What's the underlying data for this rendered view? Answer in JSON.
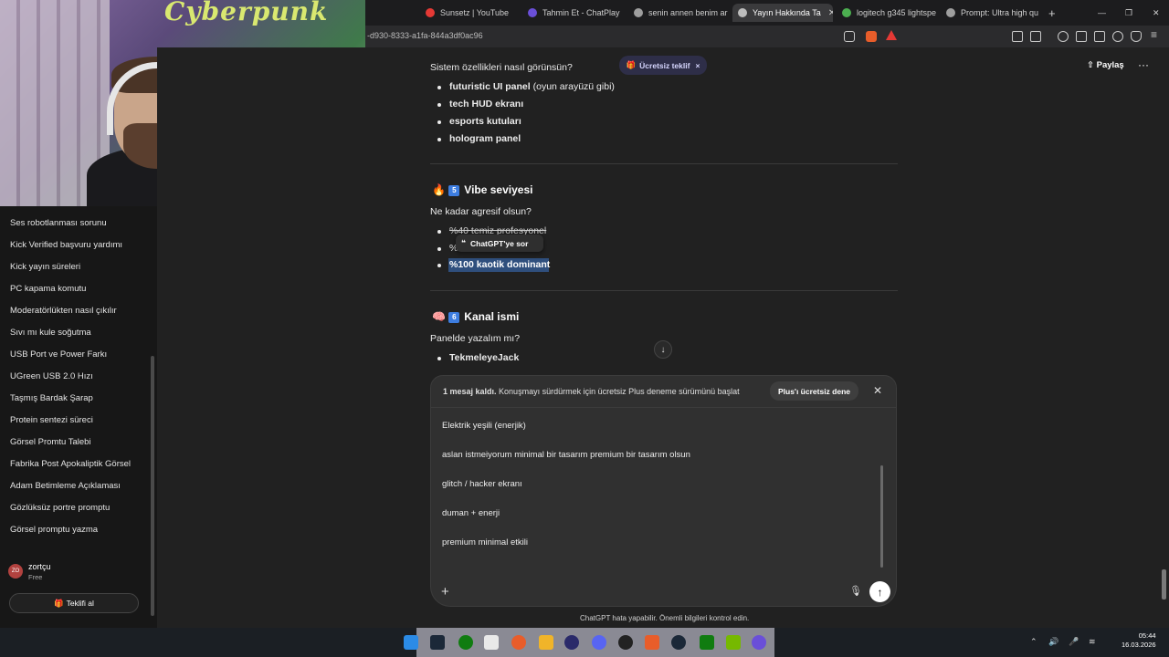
{
  "browser": {
    "tabs": [
      {
        "label": "Sunsetz | YouTube",
        "color": "#e53935"
      },
      {
        "label": "Tahmin Et - ChatPlay",
        "color": "#6a4fd8"
      },
      {
        "label": "senin annen benim ar",
        "color": "#9e9e9e"
      },
      {
        "label": "Yayın Hakkında Ta",
        "color": "#9e9e9e",
        "active": true
      },
      {
        "label": "logitech g345 lightspe",
        "color": "#4caf50"
      },
      {
        "label": "Prompt: Ultra high qu",
        "color": "#9e9e9e"
      }
    ],
    "new_tab": "+",
    "url": "-d930-8333-a1fa-844a3df0ac96",
    "win_min": "—",
    "win_max": "❐",
    "win_close": "✕"
  },
  "webcam": {
    "logo": "Cyberpunk"
  },
  "sidebar": {
    "items": [
      "Ses robotlanması sorunu",
      "Kick Verified başvuru yardımı",
      "Kick yayın süreleri",
      "PC kapama komutu",
      "Moderatörlükten nasıl çıkılır",
      "Sıvı mı kule soğutma",
      "USB Port ve Power Farkı",
      "UGreen USB 2.0 Hızı",
      "Taşmış Bardak Şarap",
      "Protein sentezi süreci",
      "Görsel Promtu Talebi",
      "Fabrika Post Apokaliptik Görsel",
      "Adam Betimleme Açıklaması",
      "Gözlüksüz portre promptu",
      "Görsel promptu yazma"
    ],
    "user": {
      "initials": "ZO",
      "name": "zortçu",
      "plan": "Free"
    },
    "offer_button": "Teklifi al"
  },
  "header": {
    "promo": "Ücretsiz teklif",
    "promo_close": "×",
    "share": "Paylaş",
    "menu": "···"
  },
  "conversation": {
    "question1": "Sistem özellikleri nasıl görünsün?",
    "list1": [
      {
        "bold": "futuristic UI panel",
        "rest": " (oyun arayüzü gibi)"
      },
      {
        "bold": "tech HUD ekranı",
        "rest": ""
      },
      {
        "bold": "esports kutuları",
        "rest": ""
      },
      {
        "bold": "hologram panel",
        "rest": ""
      }
    ],
    "section5": {
      "emoji": "🔥",
      "num": "5",
      "title": "Vibe seviyesi",
      "question": "Ne kadar agresif olsun?"
    },
    "list2": [
      "%40 temiz profesyonel",
      "%",
      "%100 kaotik dominant"
    ],
    "tooltip": "ChatGPT'ye sor",
    "section6": {
      "emoji": "🧠",
      "num": "6",
      "title": "Kanal ismi",
      "question": "Panelde yazalım mı?"
    },
    "list3": [
      "TekmeleyeJack"
    ],
    "scroll_down": "↓"
  },
  "composer": {
    "limit_bold": "1 mesaj kaldı.",
    "limit_text": " Konuşmayı sürdürmek için ücretsiz Plus deneme sürümünü başlat",
    "plus_button": "Plus'ı ücretsiz dene",
    "limit_close": "✕",
    "lines": [
      "Elektrik yeşili (enerjik)",
      "aslan istmeiyorum minimal bir tasarım premium bir tasarım olsun",
      "glitch / hacker ekranı",
      "duman + enerji",
      "premium minimal etkili"
    ],
    "add": "+",
    "mic": "🎙",
    "send": "↑",
    "disclaimer": "ChatGPT hata yapabilir. Önemli bilgileri kontrol edin."
  },
  "taskbar": {
    "time": "05:44",
    "date": "16.03.2026",
    "tray_arrow": "⌃",
    "tray_volume": "🔊",
    "tray_mic": "🎤",
    "tray_wifi": "≋"
  }
}
